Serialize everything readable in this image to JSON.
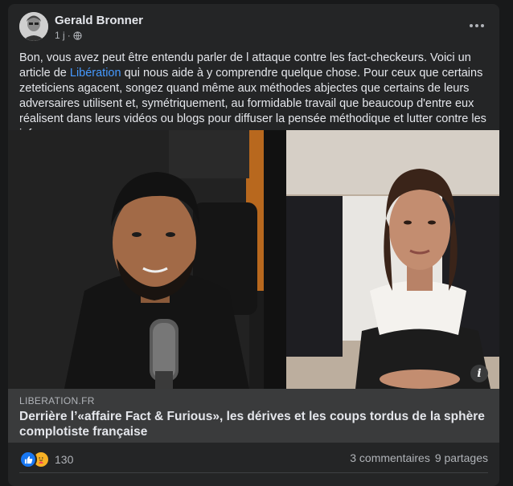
{
  "post": {
    "author": "Gerald Bronner",
    "time": "1 j",
    "dot": "·",
    "text_before_link": "Bon, vous avez peut être entendu parler de l attaque contre les fact-checkeurs. Voici un article de ",
    "link_text": "Libération",
    "text_after_link": " qui nous aide à y comprendre quelque chose. Pour ceux que certains zeteticiens agacent, songez quand même aux méthodes abjectes que certains de leurs adversaires utilisent et, symétriquement, au formidable travail que beaucoup d'entre eux réalisent dans leurs vidéos ou blogs pour diffuser la pensée méthodique et lutter contre les infox."
  },
  "link_preview": {
    "domain": "LIBERATION.FR",
    "headline": "Derrière l’«affaire Fact & Furious», les dérives et les coups tordus de la sphère complotiste française",
    "info_icon": "i"
  },
  "reactions": {
    "icons": [
      "like-icon",
      "care-icon"
    ],
    "count": "130",
    "comments": "3 commentaires",
    "shares": "9 partages"
  },
  "colors": {
    "card_bg": "#242526",
    "link_blue": "#4599ff",
    "like_blue": "#1877f2",
    "care_yellow": "#f7b125"
  }
}
